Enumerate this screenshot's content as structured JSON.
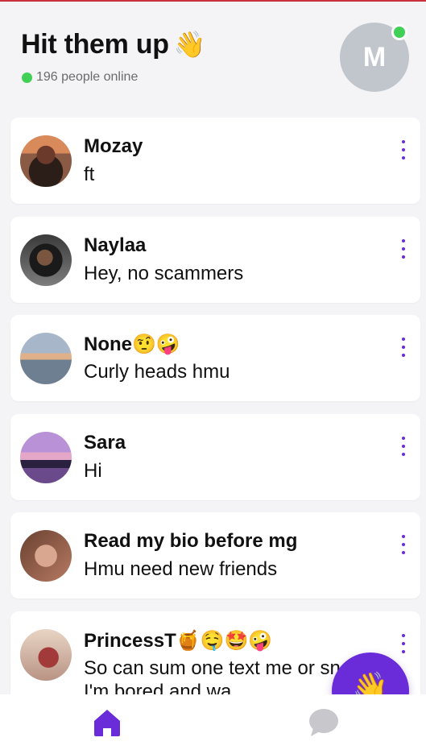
{
  "header": {
    "title": "Hit them up",
    "title_emoji": "👋",
    "online_text": "196 people online",
    "avatar_initial": "M"
  },
  "conversations": [
    {
      "name": "Mozay",
      "message": "ft",
      "photo": "avatar-photo"
    },
    {
      "name": "Naylaa",
      "message": "Hey, no scammers",
      "photo": "avatar-photo"
    },
    {
      "name": "None🤨🤪",
      "message": "Curly heads hmu",
      "photo": "avatar-photo"
    },
    {
      "name": "Sara",
      "message": "Hi",
      "photo": "avatar-photo"
    },
    {
      "name": "Read my bio before mg",
      "message": "Hmu need new friends",
      "photo": "avatar-photo"
    },
    {
      "name": "PrincessT🍯🤤🤩🤪",
      "message": "So can sum one text me or snap like I'm bored and wa",
      "photo": "avatar-photo"
    }
  ],
  "fab": {
    "emoji": "👋",
    "icon": "wave-icon"
  },
  "tabbar": {
    "home_icon": "home-icon",
    "chat_icon": "chat-bubble-icon",
    "active": "home"
  },
  "colors": {
    "accent": "#6a2bd9",
    "online": "#3fd055",
    "background": "#f4f4f6",
    "inactive_icon": "#c8c8cc"
  }
}
